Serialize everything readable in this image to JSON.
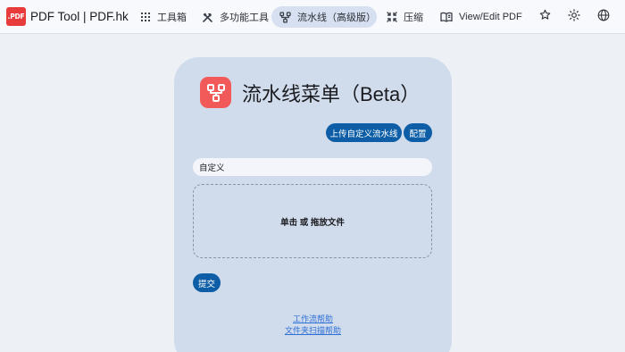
{
  "brand": {
    "logo_text": ".PDF",
    "name": "PDF Tool | PDF.hk"
  },
  "nav": {
    "items": [
      {
        "label": "工具箱",
        "icon": "grid-icon"
      },
      {
        "label": "多功能工具",
        "icon": "tools-icon"
      },
      {
        "label": "流水线（高级版）",
        "icon": "pipeline-icon",
        "active": true
      },
      {
        "label": "压缩",
        "icon": "compress-icon"
      },
      {
        "label": "View/Edit PDF",
        "icon": "book-icon"
      }
    ],
    "actions": [
      "star-icon",
      "sun-icon",
      "globe-icon"
    ]
  },
  "card": {
    "title": "流水线菜单（Beta）",
    "upload_button": "上传自定义流水线",
    "config_button": "配置",
    "pipeline_select_value": "自定义",
    "drop_zone_text": "单击 或 拖放文件",
    "submit_button": "提交",
    "help_links": [
      "工作流帮助",
      "文件夹扫描帮助"
    ]
  },
  "colors": {
    "accent": "#0d5ea6",
    "brand_red": "#e83b3b",
    "card_bg": "#d0dcec",
    "active_nav_bg": "#d6e0f1",
    "link": "#2f6fd6"
  }
}
